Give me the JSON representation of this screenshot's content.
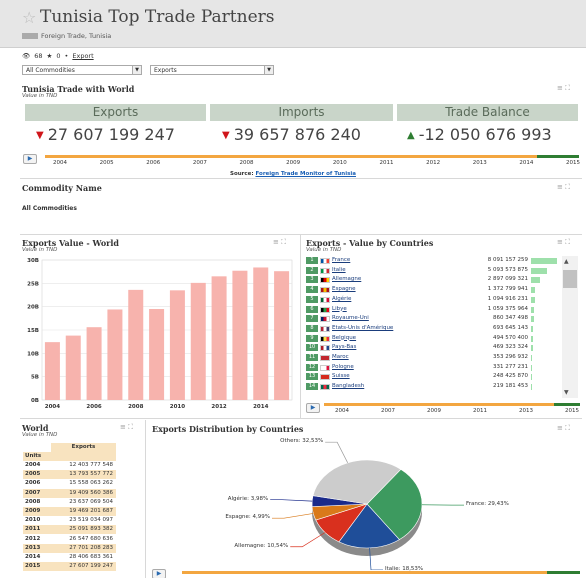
{
  "header": {
    "title": "Tunisia Top Trade Partners",
    "breadcrumb": "Foreign Trade, Tunisia"
  },
  "stats": {
    "views": "68",
    "stars": "0",
    "export_link": "Export"
  },
  "filters": {
    "commodity": "All Commodities",
    "flow": "Exports"
  },
  "trade_world": {
    "title": "Tunisia Trade with World",
    "subtitle": "Value in TND",
    "kpis": [
      {
        "label": "Exports",
        "value": "27 607 199 247",
        "trend": "down",
        "trend_icon": "▼",
        "trend_color": "#d0161b"
      },
      {
        "label": "Imports",
        "value": "39 657 876 240",
        "trend": "down",
        "trend_icon": "▼",
        "trend_color": "#d0161b"
      },
      {
        "label": "Trade Balance",
        "value": "-12 050 676 993",
        "trend": "up",
        "trend_icon": "▲",
        "trend_color": "#2e7d32"
      }
    ],
    "timeline_years": [
      "2004",
      "2005",
      "2006",
      "2007",
      "2008",
      "2009",
      "2010",
      "2011",
      "2012",
      "2013",
      "2014",
      "2015"
    ],
    "source_label": "Source:",
    "source_link": "Foreign Trade Monitor of Tunisia"
  },
  "commodity": {
    "title": "Commodity Name",
    "value": "All Commodities"
  },
  "exports_world": {
    "title": "Exports Value - World",
    "subtitle": "Value in TND"
  },
  "chart_data": {
    "type": "bar",
    "categories": [
      "2004",
      "2005",
      "2006",
      "2007",
      "2008",
      "2009",
      "2010",
      "2011",
      "2012",
      "2013",
      "2014",
      "2015"
    ],
    "values": [
      12.4,
      13.8,
      15.6,
      19.4,
      23.6,
      19.5,
      23.5,
      25.1,
      26.5,
      27.7,
      28.4,
      27.6
    ],
    "x_tick_labels": [
      "2004",
      "2006",
      "2008",
      "2010",
      "2012",
      "2014"
    ],
    "y_tick_labels": [
      "0B",
      "5B",
      "10B",
      "15B",
      "20B",
      "25B",
      "30B"
    ],
    "ylim": [
      0,
      30
    ],
    "bar_color": "#f7b3ad"
  },
  "countries": {
    "title": "Exports - Value by Countries",
    "subtitle": "Value in TND",
    "rows": [
      {
        "rank": "1",
        "name": "France",
        "value": "8 091 157 259",
        "share": 1.0,
        "flag": [
          "#0055a4",
          "#ffffff",
          "#ef4135"
        ]
      },
      {
        "rank": "2",
        "name": "Italie",
        "value": "5 093 573 875",
        "share": 0.63,
        "flag": [
          "#009246",
          "#ffffff",
          "#ce2b37"
        ]
      },
      {
        "rank": "3",
        "name": "Allemagne",
        "value": "2 897 099 321",
        "share": 0.36,
        "flag": [
          "#000000",
          "#dd0000",
          "#ffce00"
        ]
      },
      {
        "rank": "4",
        "name": "Espagne",
        "value": "1 372 799 941",
        "share": 0.17,
        "flag": [
          "#aa151b",
          "#f1bf00",
          "#aa151b"
        ]
      },
      {
        "rank": "5",
        "name": "Algérie",
        "value": "1 094 916 231",
        "share": 0.135,
        "flag": [
          "#006233",
          "#ffffff",
          "#d21034"
        ]
      },
      {
        "rank": "6",
        "name": "Libye",
        "value": "1 059 375 964",
        "share": 0.13,
        "flag": [
          "#000000",
          "#239e46",
          "#e70013"
        ]
      },
      {
        "rank": "7",
        "name": "Royaume-Uni",
        "value": "860 347 498",
        "share": 0.106,
        "flag": [
          "#012169",
          "#c8102e",
          "#ffffff"
        ]
      },
      {
        "rank": "8",
        "name": "Etats-Unis d'Amérique",
        "value": "693 645 143",
        "share": 0.086,
        "flag": [
          "#b22234",
          "#ffffff",
          "#3c3b6e"
        ]
      },
      {
        "rank": "9",
        "name": "Belgique",
        "value": "494 570 400",
        "share": 0.061,
        "flag": [
          "#000000",
          "#fae042",
          "#ed2939"
        ]
      },
      {
        "rank": "10",
        "name": "Pays-Bas",
        "value": "469 323 324",
        "share": 0.058,
        "flag": [
          "#ae1c28",
          "#ffffff",
          "#21468b"
        ]
      },
      {
        "rank": "11",
        "name": "Maroc",
        "value": "353 296 932",
        "share": 0.044,
        "flag": [
          "#c1272d",
          "#c1272d",
          "#c1272d"
        ]
      },
      {
        "rank": "12",
        "name": "Pologne",
        "value": "331 277 231",
        "share": 0.041,
        "flag": [
          "#ffffff",
          "#ffffff",
          "#dc143c"
        ]
      },
      {
        "rank": "13",
        "name": "Suisse",
        "value": "248 425 870",
        "share": 0.031,
        "flag": [
          "#d52b1e",
          "#d52b1e",
          "#d52b1e"
        ]
      },
      {
        "rank": "14",
        "name": "Bangladesh",
        "value": "219 181 453",
        "share": 0.027,
        "flag": [
          "#006a4e",
          "#f42a41",
          "#006a4e"
        ]
      }
    ],
    "timeline_labels": [
      "2004",
      "2007",
      "2009",
      "2011",
      "2013",
      "2015"
    ]
  },
  "world_table": {
    "title": "World",
    "subtitle": "Value in TND",
    "col_header": "Exports",
    "units_label": "Units",
    "rows": [
      {
        "year": "2004",
        "value": "12 403 777 548"
      },
      {
        "year": "2005",
        "value": "13 793 557 772"
      },
      {
        "year": "2006",
        "value": "15 558 063 262"
      },
      {
        "year": "2007",
        "value": "19 409 560 386"
      },
      {
        "year": "2008",
        "value": "23 637 069 504"
      },
      {
        "year": "2009",
        "value": "19 469 201 687"
      },
      {
        "year": "2010",
        "value": "23 519 034 097"
      },
      {
        "year": "2011",
        "value": "25 091 893 382"
      },
      {
        "year": "2012",
        "value": "26 547 680 636"
      },
      {
        "year": "2013",
        "value": "27 701 208 283"
      },
      {
        "year": "2014",
        "value": "28 406 683 361"
      },
      {
        "year": "2015",
        "value": "27 607 199 247"
      }
    ]
  },
  "distribution": {
    "title": "Exports Distribution by Countries",
    "slices": [
      {
        "label": "France: 29,43%",
        "pct": 29.43,
        "color": "#3d9a5f"
      },
      {
        "label": "Italie: 18,53%",
        "pct": 18.53,
        "color": "#1f4e99"
      },
      {
        "label": "Allemagne: 10,54%",
        "pct": 10.54,
        "color": "#d9301e"
      },
      {
        "label": "Espagne: 4,99%",
        "pct": 4.99,
        "color": "#d97a1a"
      },
      {
        "label": "Algérie: 3,98%",
        "pct": 3.98,
        "color": "#1a2a8a"
      },
      {
        "label": "Others: 32,53%",
        "pct": 32.53,
        "color": "#cccccc"
      }
    ]
  }
}
